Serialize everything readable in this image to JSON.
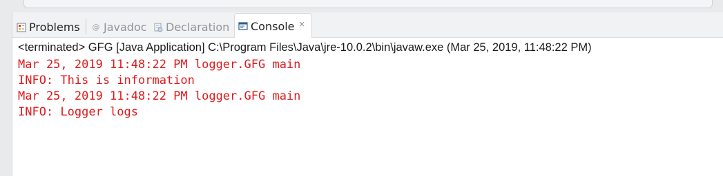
{
  "tabs": [
    {
      "label": "Problems",
      "icon": "problems-icon",
      "active": false
    },
    {
      "label": "Javadoc",
      "icon": "at-sign-icon",
      "active": false
    },
    {
      "label": "Declaration",
      "icon": "declaration-icon",
      "active": false
    },
    {
      "label": "Console",
      "icon": "console-icon",
      "active": true
    }
  ],
  "console": {
    "status": "<terminated> GFG [Java Application] C:\\Program Files\\Java\\jre-10.0.2\\bin\\javaw.exe (Mar 25, 2019, 11:48:22 PM)",
    "lines": [
      "Mar 25, 2019 11:48:22 PM logger.GFG main",
      "INFO: This is information",
      "Mar 25, 2019 11:48:22 PM logger.GFG main",
      "INFO: Logger logs"
    ],
    "output_color": "#e0191b"
  }
}
